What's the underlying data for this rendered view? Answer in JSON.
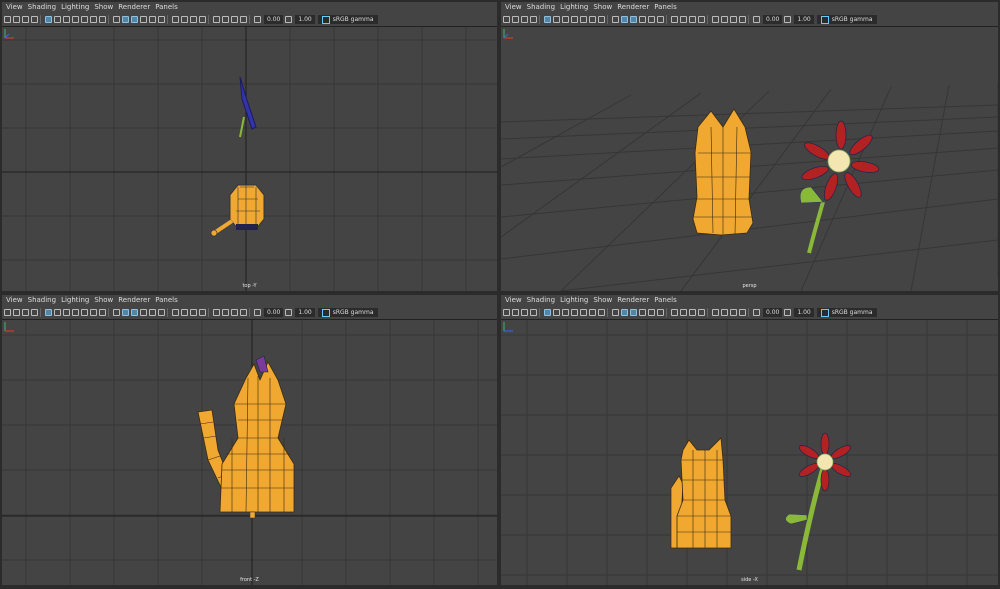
{
  "menus": [
    "View",
    "Shading",
    "Lighting",
    "Show",
    "Renderer",
    "Panels"
  ],
  "toolbar": {
    "exposure": "0.00",
    "gamma": "1.00",
    "colorspace": "sRGB gamma"
  },
  "panels": [
    {
      "camera": "top -Y"
    },
    {
      "camera": "persp"
    },
    {
      "camera": "front -Z"
    },
    {
      "camera": "side -X"
    }
  ],
  "colors": {
    "viewport_bg": "#444444",
    "grid": "#363636",
    "cat": "#f0a830",
    "flower_petal": "#b22222",
    "stem": "#8ab93a"
  },
  "icons": [
    "camera-icon",
    "grid-icon",
    "wireframe-icon",
    "shaded-icon",
    "texture-icon",
    "light-icon",
    "isolate-icon",
    "xray-icon",
    "exposure-icon",
    "gamma-icon",
    "colorspace-icon"
  ]
}
